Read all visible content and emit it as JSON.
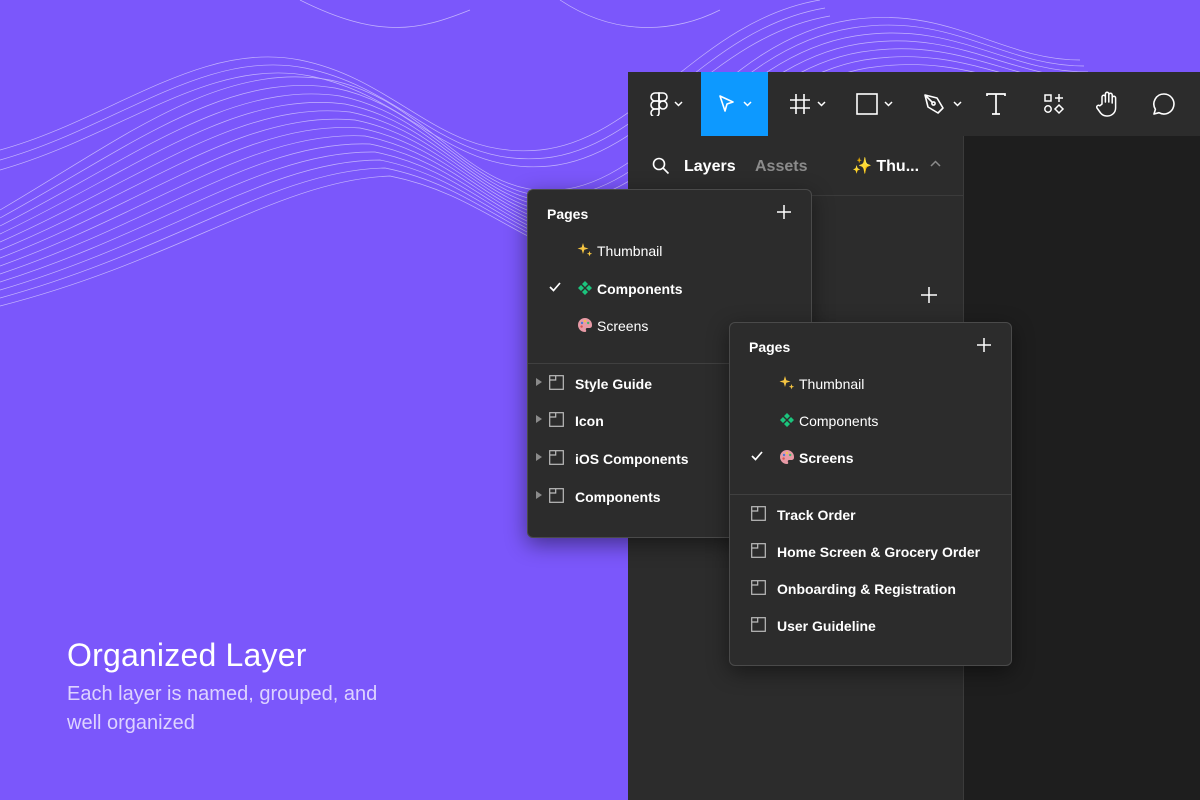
{
  "promo": {
    "title": "Organized Layer",
    "subtitle_line1": "Each layer is named, grouped, and",
    "subtitle_line2": "well organized"
  },
  "toolbar": {
    "tools": [
      {
        "name": "figma-menu",
        "icon": "figma-logo-icon"
      },
      {
        "name": "move-tool",
        "icon": "cursor-arrow-icon",
        "active": true
      },
      {
        "name": "frame-tool",
        "icon": "hash-frame-icon"
      },
      {
        "name": "shape-tool",
        "icon": "rectangle-icon"
      },
      {
        "name": "pen-tool",
        "icon": "pen-nib-icon"
      },
      {
        "name": "text-tool",
        "icon": "text-t-icon"
      },
      {
        "name": "resources-tool",
        "icon": "resources-icon"
      },
      {
        "name": "hand-tool",
        "icon": "hand-icon"
      },
      {
        "name": "comment-tool",
        "icon": "speech-bubble-icon"
      }
    ],
    "accent": "#0d99ff"
  },
  "left_panel": {
    "tab_layers": "Layers",
    "tab_assets": "Assets",
    "current_page": "✨ Thu..."
  },
  "popup_components": {
    "heading": "Pages",
    "pages": [
      {
        "label": "Thumbnail",
        "emoji": "✨",
        "selected": false
      },
      {
        "label": "Components",
        "emoji": "❇",
        "selected": true
      },
      {
        "label": "Screens",
        "emoji": "🎨",
        "selected": false
      }
    ],
    "layers": [
      "Style Guide",
      "Icon",
      "iOS Components",
      "Components"
    ]
  },
  "popup_screens": {
    "heading": "Pages",
    "pages": [
      {
        "label": "Thumbnail",
        "emoji": "✨",
        "selected": false
      },
      {
        "label": "Components",
        "emoji": "❇",
        "selected": false
      },
      {
        "label": "Screens",
        "emoji": "🎨",
        "selected": true
      }
    ],
    "layers": [
      "Track Order",
      "Home Screen & Grocery Order",
      "Onboarding & Registration",
      "User Guideline"
    ]
  },
  "colors": {
    "background": "#7b57fb",
    "panel": "#2c2c2c",
    "canvas": "#1e1e1e",
    "sparkle": "#f5c542",
    "components_icon": "#1bc47d",
    "palette_icon": "#e89aa6"
  }
}
